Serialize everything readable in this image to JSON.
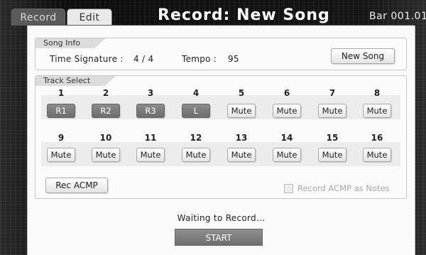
{
  "tabs": [
    {
      "label": "Record",
      "active": false
    },
    {
      "label": "Edit",
      "active": true
    }
  ],
  "header": {
    "title": "Record: New Song",
    "bar_readout": "Bar 001.01"
  },
  "song_info": {
    "group_label": "Song Info",
    "time_signature_label": "Time Signature :",
    "time_signature_value": "4 / 4",
    "tempo_label": "Tempo :",
    "tempo_value": "95",
    "new_song_label": "New Song"
  },
  "track_select": {
    "group_label": "Track Select",
    "row1": [
      {
        "num": "1",
        "label": "R1",
        "state": "record"
      },
      {
        "num": "2",
        "label": "R2",
        "state": "record"
      },
      {
        "num": "3",
        "label": "R3",
        "state": "record"
      },
      {
        "num": "4",
        "label": "L",
        "state": "record"
      },
      {
        "num": "5",
        "label": "Mute",
        "state": "mute"
      },
      {
        "num": "6",
        "label": "Mute",
        "state": "mute"
      },
      {
        "num": "7",
        "label": "Mute",
        "state": "mute"
      },
      {
        "num": "8",
        "label": "Mute",
        "state": "mute"
      }
    ],
    "row2": [
      {
        "num": "9",
        "label": "Mute",
        "state": "mute"
      },
      {
        "num": "10",
        "label": "Mute",
        "state": "mute"
      },
      {
        "num": "11",
        "label": "Mute",
        "state": "mute"
      },
      {
        "num": "12",
        "label": "Mute",
        "state": "mute"
      },
      {
        "num": "13",
        "label": "Mute",
        "state": "mute"
      },
      {
        "num": "14",
        "label": "Mute",
        "state": "mute"
      },
      {
        "num": "15",
        "label": "Mute",
        "state": "mute"
      },
      {
        "num": "16",
        "label": "Mute",
        "state": "mute"
      }
    ],
    "rec_acmp_label": "Rec ACMP",
    "record_acmp_notes_label": "Record ACMP as Notes",
    "record_acmp_notes_checked": false
  },
  "status_text": "Waiting to Record...",
  "start_label": "START"
}
